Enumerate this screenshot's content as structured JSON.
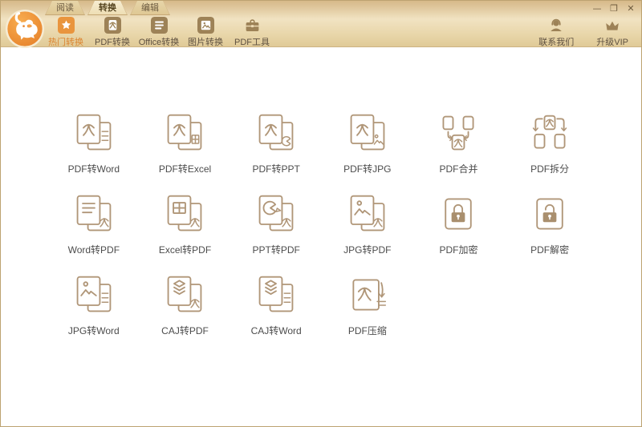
{
  "window": {
    "controls": {
      "minimize": "—",
      "maximize": "❐",
      "close": "✕"
    }
  },
  "tabs": [
    {
      "label": "阅读",
      "active": false
    },
    {
      "label": "转换",
      "active": true
    },
    {
      "label": "编辑",
      "active": false
    }
  ],
  "toolbar": {
    "items": [
      {
        "label": "热门转换",
        "icon": "star",
        "active": true
      },
      {
        "label": "PDF转换",
        "icon": "pdf-file",
        "active": false
      },
      {
        "label": "Office转换",
        "icon": "office-doc",
        "active": false
      },
      {
        "label": "图片转换",
        "icon": "image-file",
        "active": false
      },
      {
        "label": "PDF工具",
        "icon": "toolbox",
        "active": false
      }
    ],
    "right_items": [
      {
        "label": "联系我们",
        "icon": "headset-person"
      },
      {
        "label": "升级VIP",
        "icon": "crown"
      }
    ]
  },
  "grid": {
    "items": [
      {
        "label": "PDF转Word",
        "icon": "pdf-to-word"
      },
      {
        "label": "PDF转Excel",
        "icon": "pdf-to-excel"
      },
      {
        "label": "PDF转PPT",
        "icon": "pdf-to-ppt"
      },
      {
        "label": "PDF转JPG",
        "icon": "pdf-to-jpg"
      },
      {
        "label": "PDF合并",
        "icon": "pdf-merge"
      },
      {
        "label": "PDF拆分",
        "icon": "pdf-split"
      },
      {
        "label": "Word转PDF",
        "icon": "word-to-pdf"
      },
      {
        "label": "Excel转PDF",
        "icon": "excel-to-pdf"
      },
      {
        "label": "PPT转PDF",
        "icon": "ppt-to-pdf"
      },
      {
        "label": "JPG转PDF",
        "icon": "jpg-to-pdf"
      },
      {
        "label": "PDF加密",
        "icon": "pdf-encrypt"
      },
      {
        "label": "PDF解密",
        "icon": "pdf-decrypt"
      },
      {
        "label": "JPG转Word",
        "icon": "jpg-to-word"
      },
      {
        "label": "CAJ转PDF",
        "icon": "caj-to-pdf"
      },
      {
        "label": "CAJ转Word",
        "icon": "caj-to-word"
      },
      {
        "label": "PDF压缩",
        "icon": "pdf-compress"
      }
    ]
  },
  "colors": {
    "accent_orange": "#e8943a",
    "icon_brown": "#9d8257",
    "grid_icon_stroke": "#b09678",
    "header_top": "#d7ba8a",
    "header_bottom": "#e0ca97",
    "label_dark": "#4c4c4c"
  }
}
